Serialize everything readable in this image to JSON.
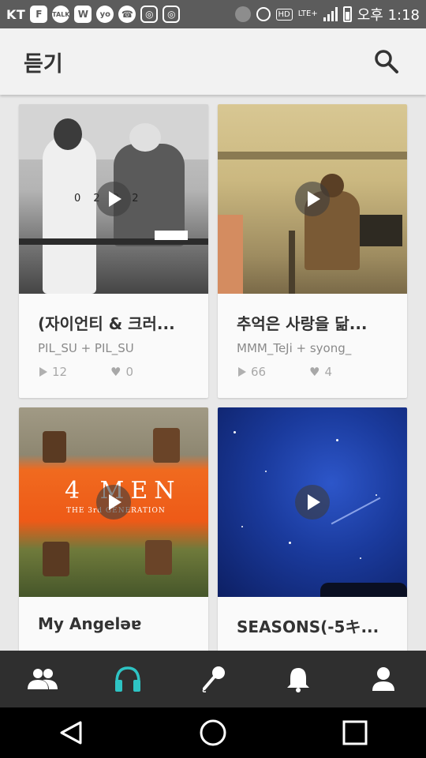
{
  "status_bar": {
    "carrier": "KT",
    "time": "오후 1:18",
    "hd": "HD",
    "lte": "LTE+",
    "app_icons": [
      "F",
      "TALK",
      "W",
      "yo",
      "☎",
      "◎",
      "◎"
    ]
  },
  "app_bar": {
    "title": "듣기",
    "search_icon": "search-icon"
  },
  "cards": [
    {
      "title": "(자이언티 & 크러...",
      "artists": "PIL_SU + PIL_SU",
      "plays": "12",
      "likes": "0",
      "thumb_text": "0 2 0 2"
    },
    {
      "title": "추억은 사랑을 닮...",
      "artists": "MMM_TeJi + syong_",
      "plays": "66",
      "likes": "4",
      "thumb_text": ""
    },
    {
      "title": "My Angeləɐ",
      "artists": "",
      "plays": "",
      "likes": "",
      "thumb_text": "4 MEN",
      "thumb_subtext": "THE 3rd GENERATION"
    },
    {
      "title": "SEASONS(-5キ...",
      "artists": "",
      "plays": "",
      "likes": "",
      "thumb_text": ""
    }
  ],
  "bottom_nav": [
    "people-icon",
    "headphones-icon",
    "microphone-icon",
    "bell-icon",
    "person-icon"
  ],
  "colors": {
    "accent": "#2ec4c4",
    "status_bar": "#5c5c5c",
    "app_bar": "#f2f2f2",
    "background": "#e8e8e8",
    "bottom_nav": "#2f2f2f"
  }
}
